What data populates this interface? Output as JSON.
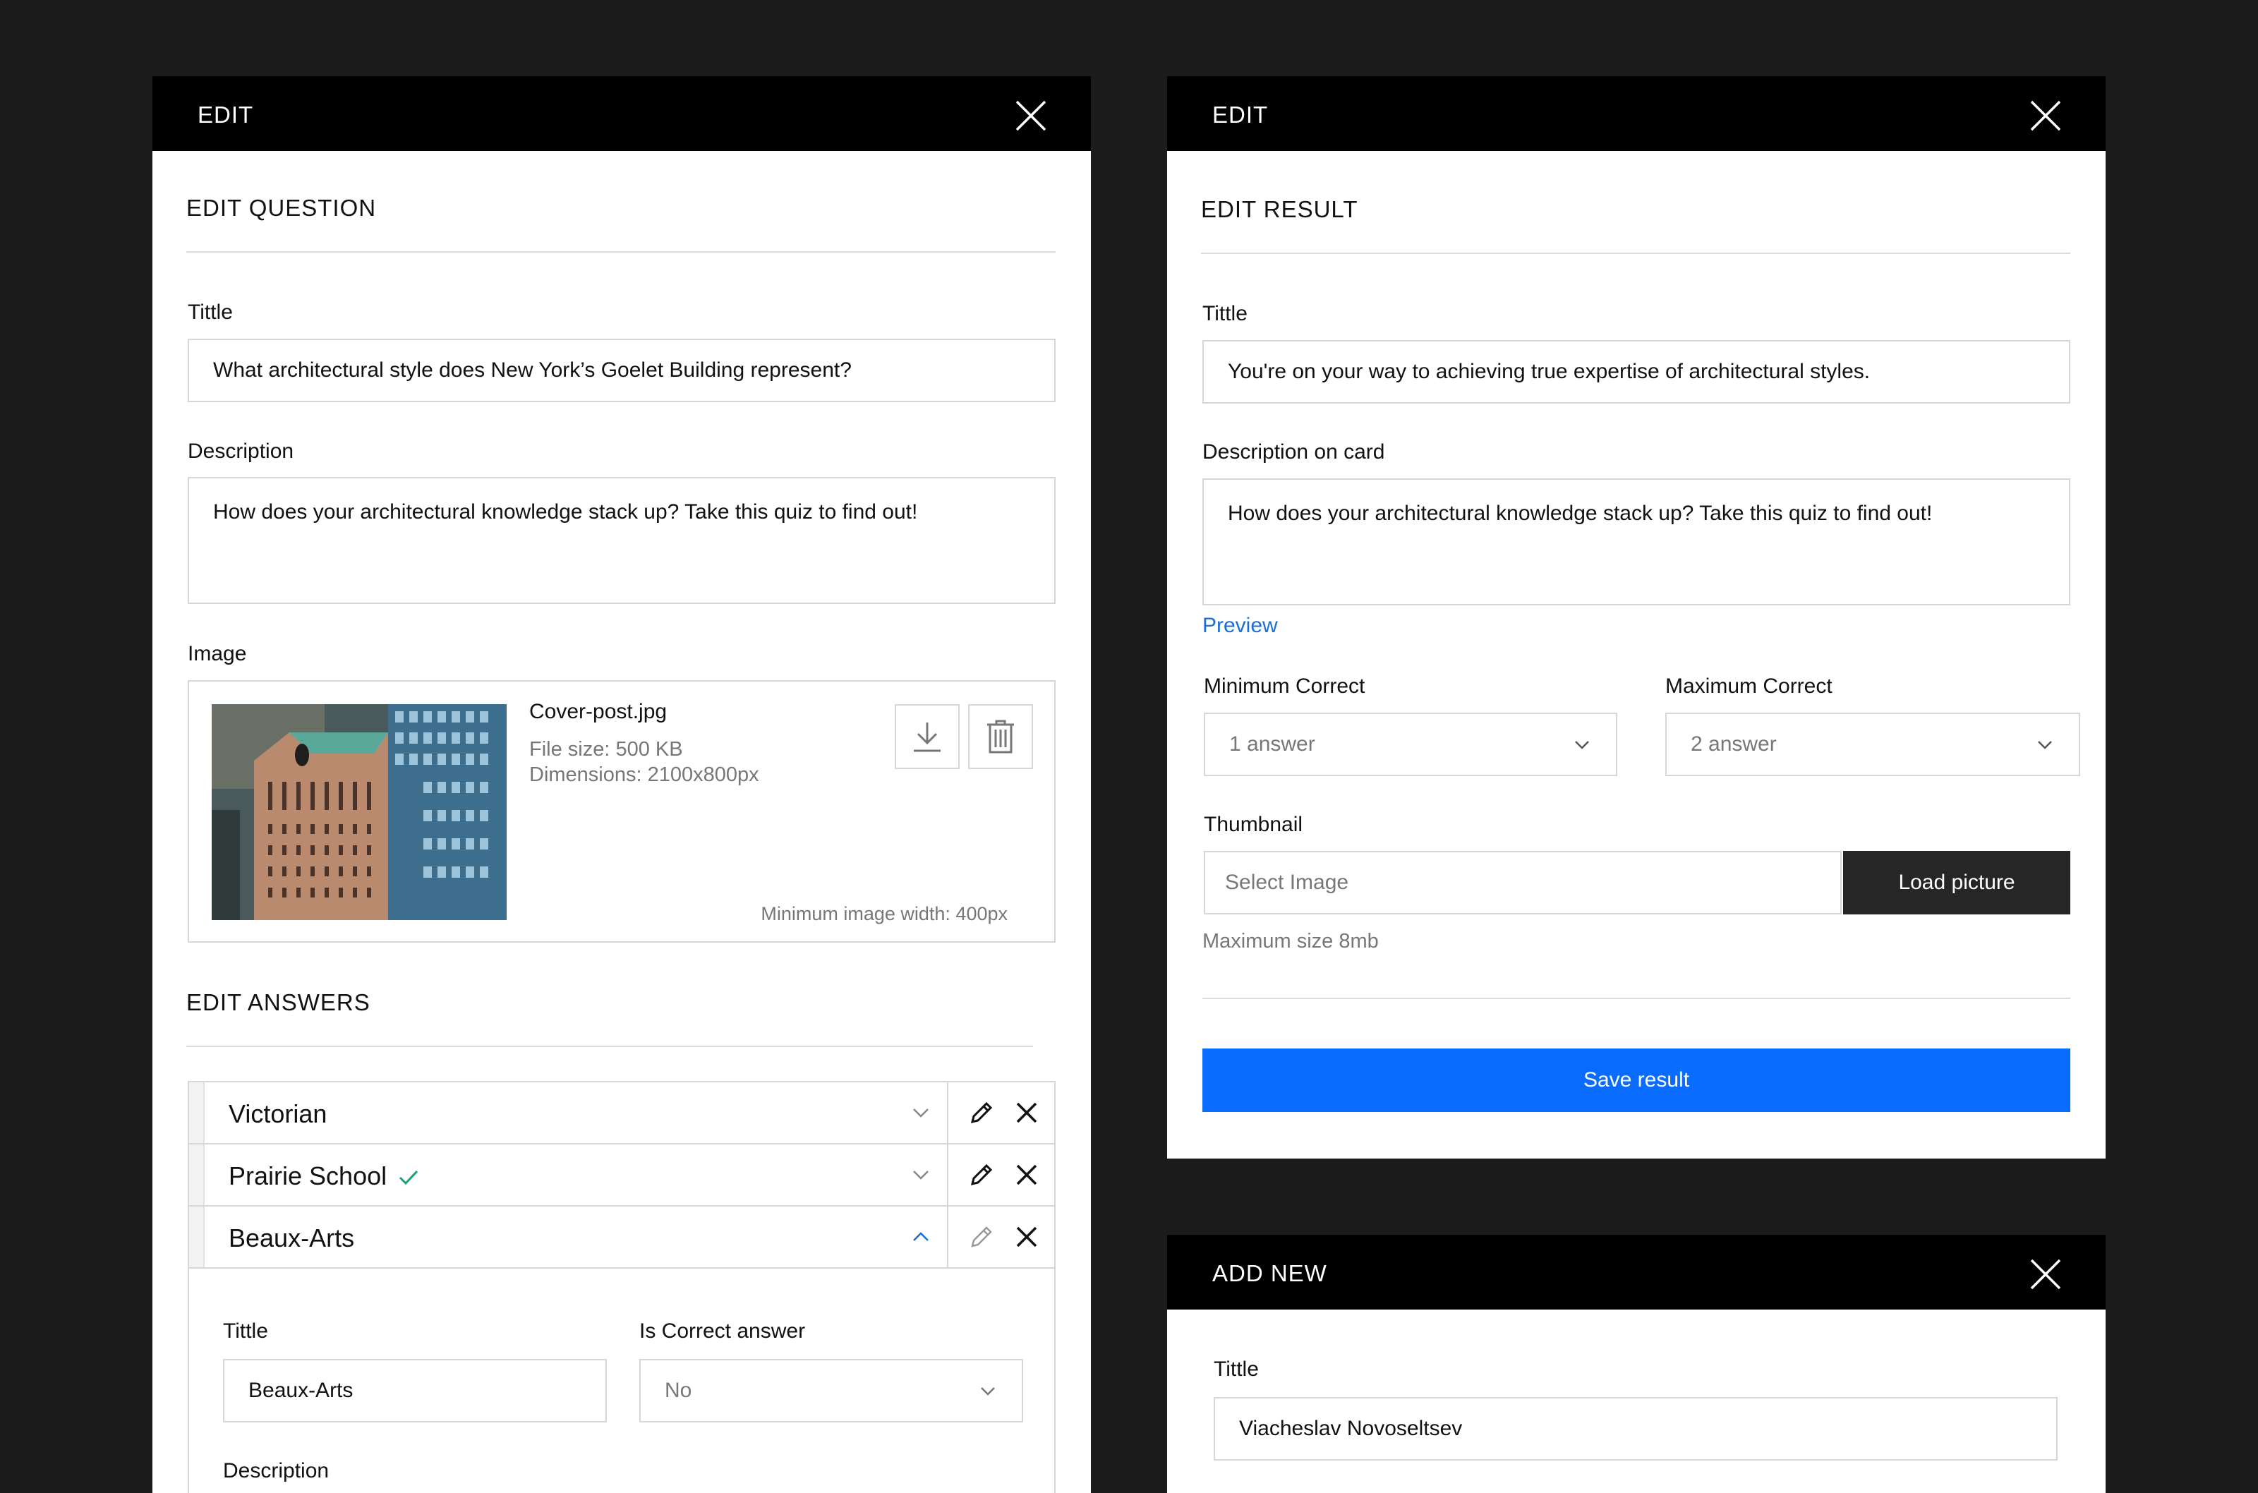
{
  "edit_question_panel": {
    "header_title": "EDIT",
    "section_title": "EDIT QUESTION",
    "title_label": "Tittle",
    "title_value": "What architectural style does New York’s Goelet Building represent?",
    "description_label": "Description",
    "description_value": "How does your architectural knowledge stack up? Take this quiz to find out!",
    "image_label": "Image",
    "image": {
      "file_name": "Cover-post.jpg",
      "file_size": "File size: 500 KB",
      "dimensions": "Dimensions: 2100x800px",
      "min_width_note": "Minimum image width: 400px"
    },
    "answers_title": "EDIT ANSWERS",
    "answers": [
      {
        "label": "Victorian",
        "correct": false,
        "expanded": false
      },
      {
        "label": "Prairie School",
        "correct": true,
        "expanded": false
      },
      {
        "label": "Beaux-Arts",
        "correct": false,
        "expanded": true
      }
    ],
    "expanded_answer": {
      "title_label": "Tittle",
      "title_value": "Beaux-Arts",
      "correct_label": "Is Correct answer",
      "correct_value": "No",
      "description_label": "Description"
    }
  },
  "edit_result_panel": {
    "header_title": "EDIT",
    "section_title": "EDIT RESULT",
    "title_label": "Tittle",
    "title_value": "You're on your way to achieving true expertise of architectural styles.",
    "description_label": "Description on card",
    "description_value": "How does your architectural knowledge stack up? Take this quiz to find out!",
    "preview_link": "Preview",
    "min_correct_label": "Minimum Correct",
    "min_correct_value": "1 answer",
    "max_correct_label": "Maximum Correct",
    "max_correct_value": "2 answer",
    "thumbnail_label": "Thumbnail",
    "thumbnail_placeholder": "Select Image",
    "load_button": "Load picture",
    "max_size_note": "Maximum size 8mb",
    "save_button": "Save result"
  },
  "add_new_panel": {
    "header_title": "ADD NEW",
    "title_label": "Tittle",
    "title_value": "Viacheslav Novoseltsev"
  },
  "colors": {
    "background": "#1c1c1c",
    "header": "#000000",
    "accent_blue": "#0a6cff",
    "link_blue": "#1a6ed8",
    "check_green": "#1aa07a",
    "dark_button": "#262626"
  }
}
